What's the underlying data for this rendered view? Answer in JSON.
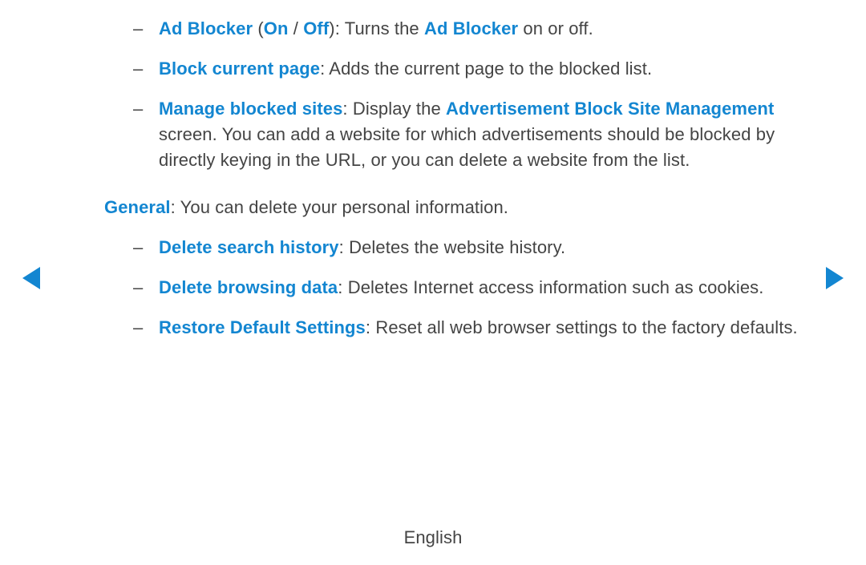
{
  "items": [
    {
      "label": "Ad Blocker",
      "paren_open": " (",
      "opt1": "On",
      "sep": " / ",
      "opt2": "Off",
      "paren_close": ")",
      "pre": ": Turns the ",
      "inline_hl": "Ad Blocker",
      "post": " on or off."
    },
    {
      "label": "Block current page",
      "desc": ": Adds the current page to the blocked list."
    },
    {
      "label": "Manage blocked sites",
      "pre": ": Display the ",
      "inline_hl": "Advertisement Block Site Management",
      "post": " screen. You can add a website for which advertisements should be blocked by directly keying in the URL, or you can delete a website from the list."
    }
  ],
  "section": {
    "label": "General",
    "desc": ": You can delete your personal information."
  },
  "items2": [
    {
      "label": "Delete search history",
      "desc": ": Deletes the website history."
    },
    {
      "label": "Delete browsing data",
      "desc": ": Deletes Internet access information such as cookies."
    },
    {
      "label": "Restore Default Settings",
      "desc": ": Reset all web browser settings to the factory defaults."
    }
  ],
  "footer": "English",
  "dash": "–"
}
